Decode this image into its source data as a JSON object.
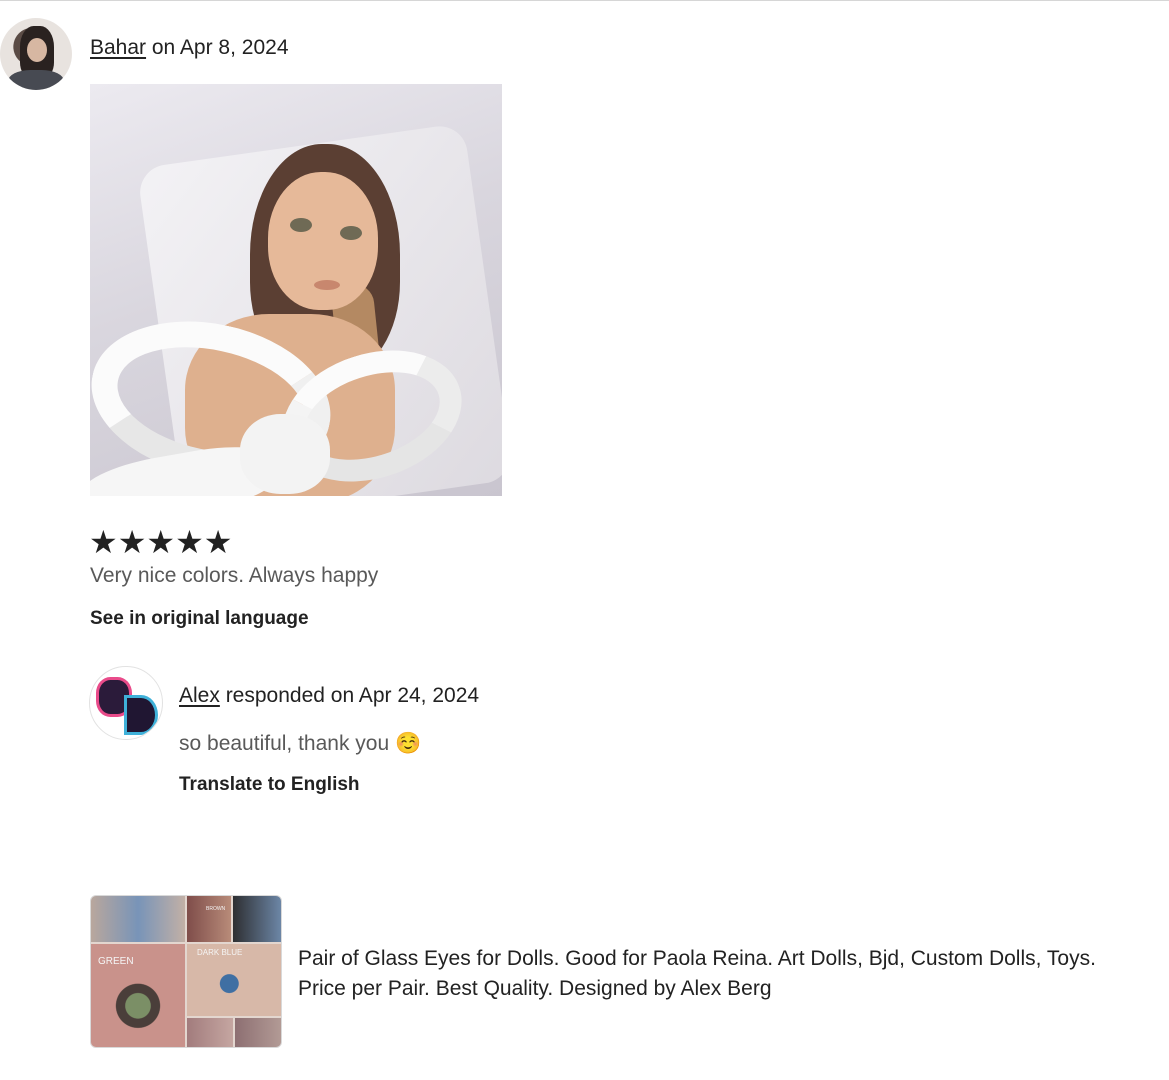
{
  "review": {
    "reviewer_name": "Bahar",
    "date_text": " on Apr 8, 2024",
    "rating": 5,
    "stars_text": "★★★★★",
    "text": "Very nice colors. Always happy",
    "see_original_label": "See in original language"
  },
  "response": {
    "seller_name": "Alex",
    "date_text": " responded on Apr 24, 2024",
    "text": "so beautiful, thank you ☺️",
    "translate_label": "Translate to English"
  },
  "product": {
    "thumbnail_labels": {
      "green": "GREEN",
      "dark_blue": "DARK BLUE",
      "brown": "BROWN"
    },
    "title": "Pair of Glass Eyes for Dolls. Good for Paola Reina. Art Dolls, Bjd, Custom Dolls, Toys. Price per Pair. Best Quality. Designed by Alex Berg"
  }
}
